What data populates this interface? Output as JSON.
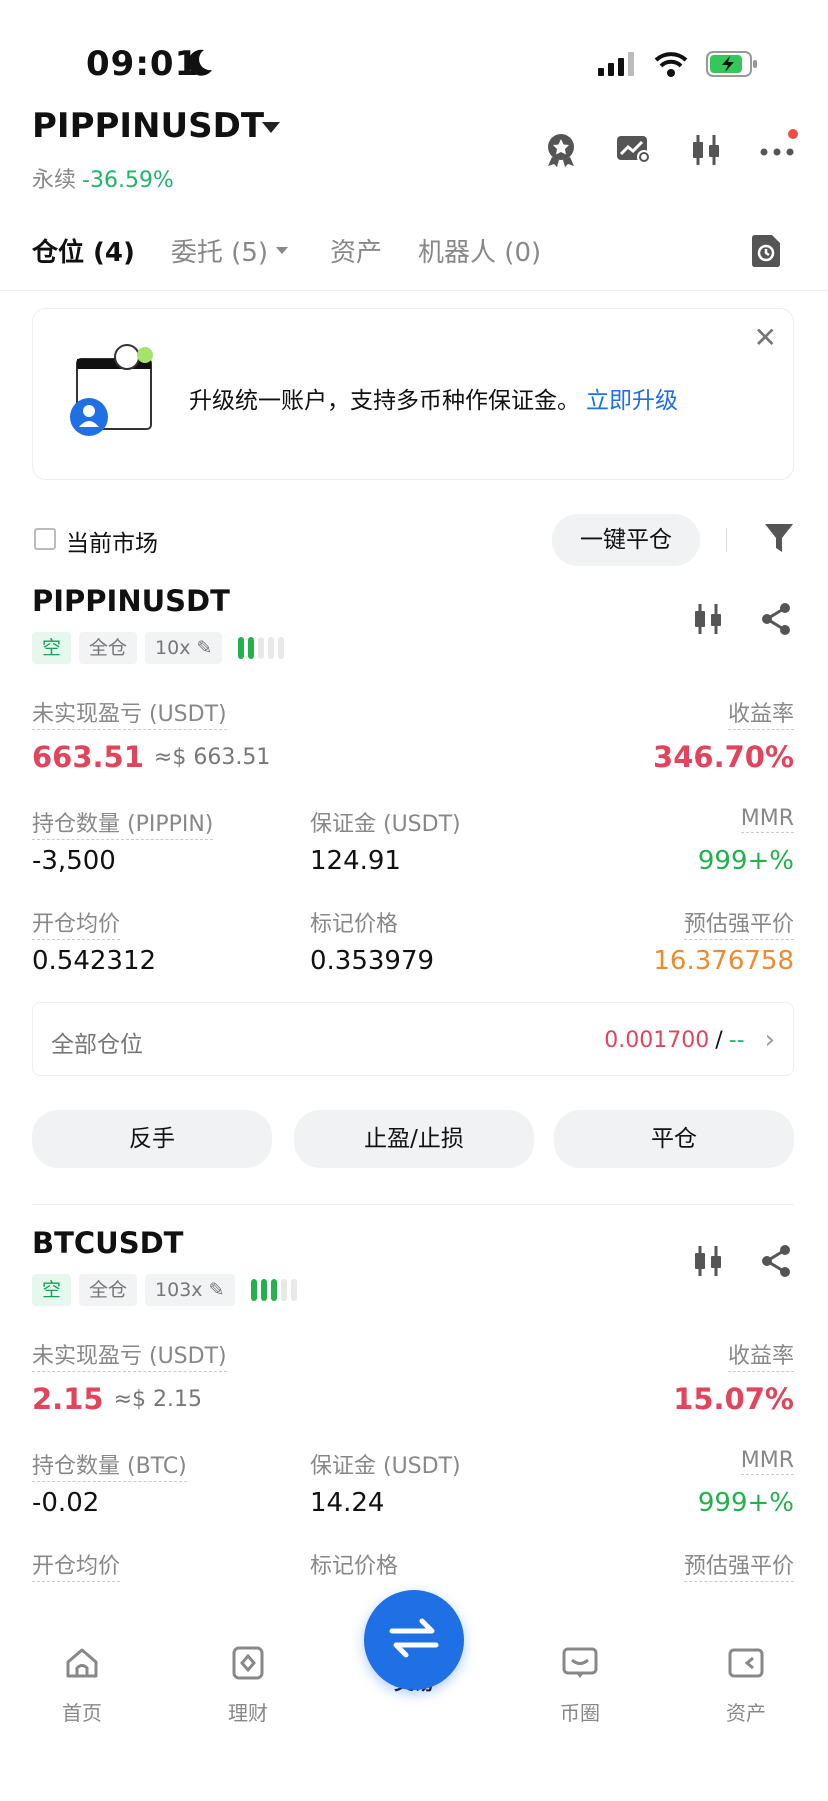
{
  "status": {
    "time": "09:01"
  },
  "header": {
    "symbol": "PIPPINUSDT",
    "type": "永续",
    "change": "-36.59%"
  },
  "tabs": [
    {
      "label": "仓位 (4)"
    },
    {
      "label": "委托 (5)"
    },
    {
      "label": "资产"
    },
    {
      "label": "机器人 (0)"
    }
  ],
  "banner": {
    "text": "升级统一账户，支持多币种作保证金。",
    "link": "立即升级"
  },
  "filter": {
    "current_market": "当前市场",
    "close_all": "一键平仓"
  },
  "positions": [
    {
      "symbol": "PIPPINUSDT",
      "side": "空",
      "margin_mode": "全仓",
      "leverage": "10x",
      "pnl_label": "未实现盈亏 (USDT)",
      "pnl": "663.51",
      "pnl_approx": "≈$ 663.51",
      "roe_label": "收益率",
      "roe": "346.70%",
      "qty_label": "持仓数量 (PIPPIN)",
      "qty": "-3,500",
      "margin_label": "保证金 (USDT)",
      "margin": "124.91",
      "mmr_label": "MMR",
      "mmr": "999+%",
      "entry_label": "开仓均价",
      "entry": "0.542312",
      "mark_label": "标记价格",
      "mark": "0.353979",
      "liq_label": "预估强平价",
      "liq": "16.376758",
      "all_pos_label": "全部仓位",
      "all_pos_value": "0.001700",
      "all_pos_sep": "/",
      "all_pos_dash": "--",
      "actions": [
        "反手",
        "止盈/止损",
        "平仓"
      ]
    },
    {
      "symbol": "BTCUSDT",
      "side": "空",
      "margin_mode": "全仓",
      "leverage": "103x",
      "pnl_label": "未实现盈亏 (USDT)",
      "pnl": "2.15",
      "pnl_approx": "≈$ 2.15",
      "roe_label": "收益率",
      "roe": "15.07%",
      "qty_label": "持仓数量 (BTC)",
      "qty": "-0.02",
      "margin_label": "保证金 (USDT)",
      "margin": "14.24",
      "mmr_label": "MMR",
      "mmr": "999+%",
      "entry_label": "开仓均价",
      "mark_label": "标记价格",
      "liq_label": "预估强平价"
    }
  ],
  "nav": [
    {
      "label": "首页"
    },
    {
      "label": "理财"
    },
    {
      "label": "交易"
    },
    {
      "label": "币圈"
    },
    {
      "label": "资产"
    }
  ]
}
